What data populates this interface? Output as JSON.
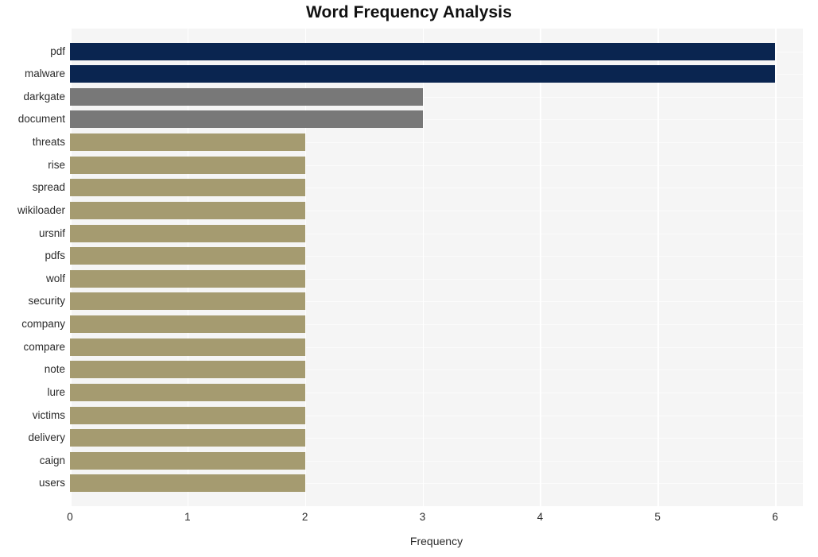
{
  "chart_data": {
    "type": "bar",
    "orientation": "horizontal",
    "title": "Word Frequency Analysis",
    "xlabel": "Frequency",
    "ylabel": "",
    "xlim": [
      0,
      6
    ],
    "xticks": [
      0,
      1,
      2,
      3,
      4,
      5,
      6
    ],
    "xtick_labels": [
      "0",
      "1",
      "2",
      "3",
      "4",
      "5",
      "6"
    ],
    "grid": true,
    "legend": "none",
    "background": "#f5f5f5",
    "categories": [
      "pdf",
      "malware",
      "darkgate",
      "document",
      "threats",
      "rise",
      "spread",
      "wikiloader",
      "ursnif",
      "pdfs",
      "wolf",
      "security",
      "company",
      "compare",
      "note",
      "lure",
      "victims",
      "delivery",
      "caign",
      "users"
    ],
    "values": [
      6,
      6,
      3,
      3,
      2,
      2,
      2,
      2,
      2,
      2,
      2,
      2,
      2,
      2,
      2,
      2,
      2,
      2,
      2,
      2
    ],
    "bar_colors": [
      "#0a2550",
      "#0a2550",
      "#787878",
      "#787878",
      "#a59b70",
      "#a59b70",
      "#a59b70",
      "#a59b70",
      "#a59b70",
      "#a59b70",
      "#a59b70",
      "#a59b70",
      "#a59b70",
      "#a59b70",
      "#a59b70",
      "#a59b70",
      "#a59b70",
      "#a59b70",
      "#a59b70",
      "#a59b70"
    ],
    "palette": {
      "high": "#0a2550",
      "medium": "#787878",
      "low": "#a59b70",
      "plot_background": "#f5f5f5",
      "gridline": "#ffffff",
      "text": "#2b2b2b",
      "title": "#111111"
    }
  }
}
